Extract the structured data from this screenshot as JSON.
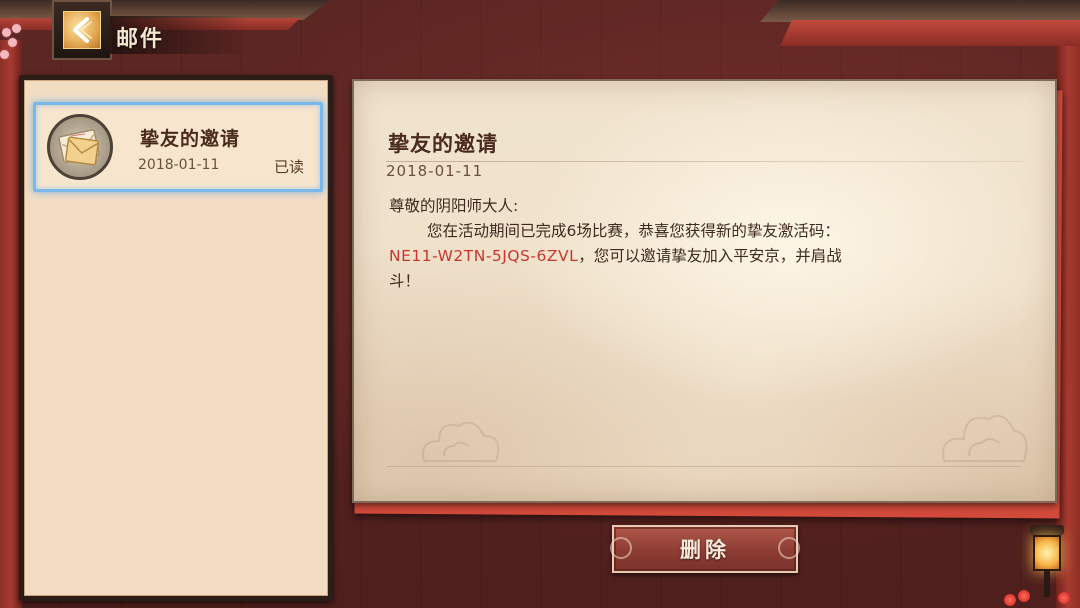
{
  "header": {
    "title": "邮件",
    "back_icon": "back-arrow-icon"
  },
  "mail_list": {
    "items": [
      {
        "title": "挚友的邀请",
        "date": "2018-01-11",
        "status": "已读",
        "icon": "envelope-icon",
        "selected": true
      }
    ]
  },
  "detail": {
    "title": "挚友的邀请",
    "date": "2018-01-11",
    "greeting": "尊敬的阴阳师大人:",
    "body_line1": "您在活动期间已完成6场比赛，恭喜您获得新的挚友激活码：",
    "code": "NE11-W2TN-5JQS-6ZVL",
    "body_line2": "，您可以邀请挚友加入平安京，并肩战",
    "body_line3": "斗！"
  },
  "actions": {
    "delete_label": "删除"
  },
  "colors": {
    "code_text": "#c8362f",
    "selection_border": "#7ab8ea",
    "button_bg": "#8d3c33"
  }
}
